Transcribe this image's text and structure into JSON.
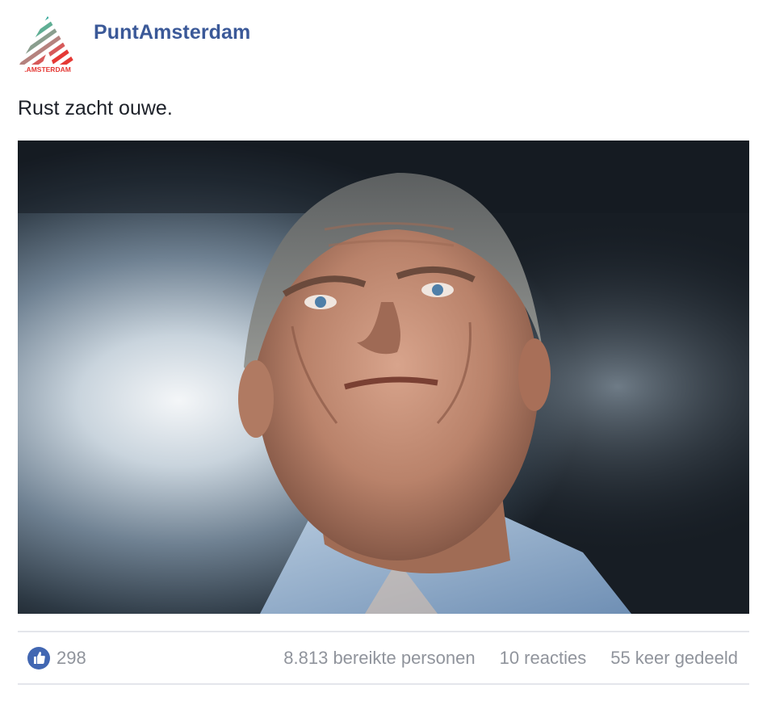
{
  "post": {
    "page_name": "PuntAmsterdam",
    "logo_text": ".AMSTERDAM",
    "logo_icon": "punt-amsterdam-logo",
    "text": "Rust zacht ouwe.",
    "photo_alt": "portrait photo"
  },
  "stats": {
    "like_icon": "thumbs-up-icon",
    "likes": "298",
    "reach": "8.813 bereikte personen",
    "comments": "10 reacties",
    "shares": "55 keer gedeeld"
  },
  "colors": {
    "brand_blue": "#3b5998",
    "like_blue": "#4267b2",
    "logo_teal": "#2aa6a0",
    "logo_red": "#e53935",
    "muted_text": "#90949c"
  }
}
